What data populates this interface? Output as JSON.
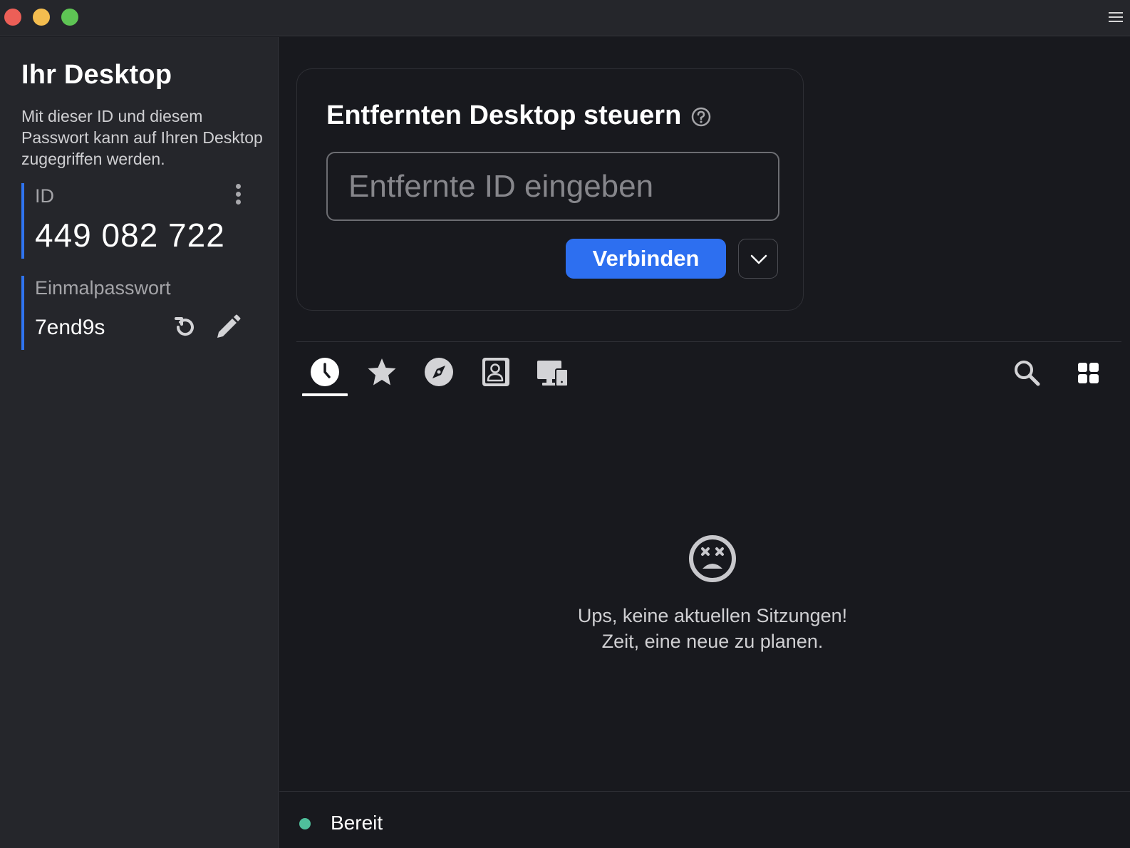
{
  "sidebar": {
    "title": "Ihr Desktop",
    "description": "Mit dieser ID und diesem Passwort kann auf Ihren Desktop zugegriffen werden.",
    "id_label": "ID",
    "id_value": "449 082 722",
    "password_label": "Einmalpasswort",
    "password_value": "7end9s"
  },
  "connect": {
    "title": "Entfernten Desktop steuern",
    "input_placeholder": "Entfernte ID eingeben",
    "input_value": "",
    "connect_label": "Verbinden"
  },
  "tabs": [
    {
      "icon": "clock-icon",
      "active": true
    },
    {
      "icon": "star-icon",
      "active": false
    },
    {
      "icon": "compass-icon",
      "active": false
    },
    {
      "icon": "contact-book-icon",
      "active": false
    },
    {
      "icon": "devices-icon",
      "active": false
    }
  ],
  "empty_state": {
    "line1": "Ups, keine aktuellen Sitzungen!",
    "line2": "Zeit, eine neue zu planen."
  },
  "status": {
    "text": "Bereit",
    "color": "#4fbf9b"
  },
  "colors": {
    "accent": "#2d6ff0",
    "sidebar_bg": "#25262b",
    "main_bg": "#18191e"
  }
}
